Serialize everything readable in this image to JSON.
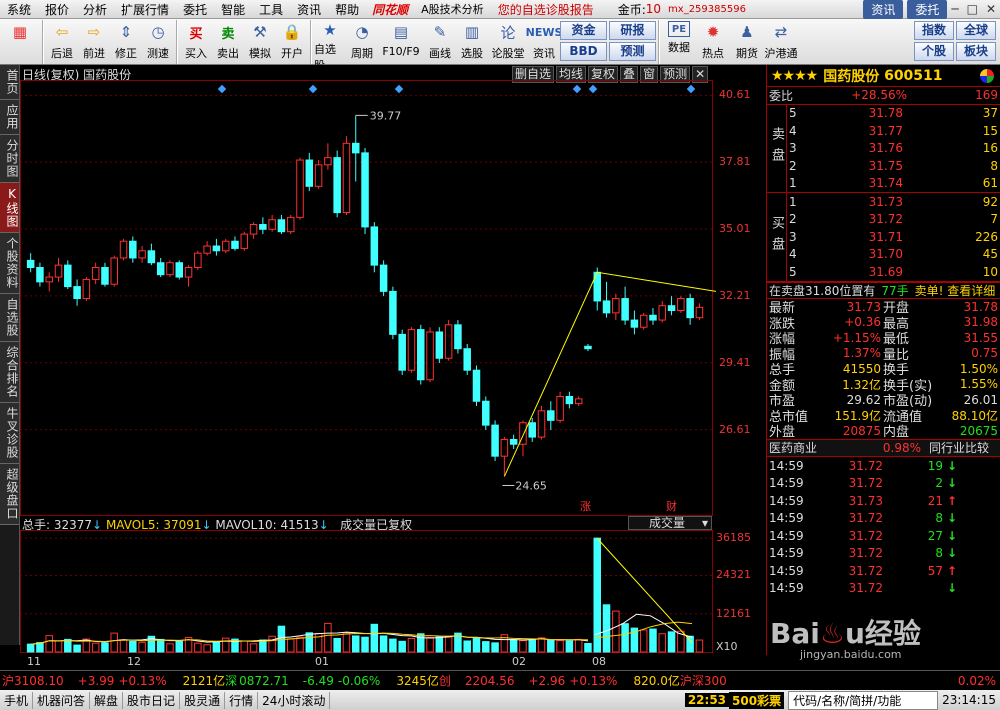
{
  "menu": {
    "items": [
      "系统",
      "报价",
      "分析",
      "扩展行情",
      "委托",
      "智能",
      "工具",
      "资讯",
      "帮助"
    ],
    "logo": "同花顺",
    "subtitle": "A股技术分析",
    "report": "您的自选诊股报告",
    "gold_label": "金币:",
    "gold_value": "10",
    "user": "mx_259385596",
    "btn_news": "资讯",
    "btn_trade": "委托"
  },
  "toolbar": {
    "buttons": [
      {
        "label": "",
        "icon": "grid-icon"
      },
      {
        "label": "后退",
        "icon": "back-arrow-icon"
      },
      {
        "label": "前进",
        "icon": "forward-arrow-icon"
      },
      {
        "label": "修正",
        "icon": "up-down-icon"
      },
      {
        "label": "测速",
        "icon": "clock-icon"
      },
      {
        "label": "买入",
        "icon": "buy-icon"
      },
      {
        "label": "卖出",
        "icon": "sell-icon"
      },
      {
        "label": "模拟",
        "icon": "hammer-icon"
      },
      {
        "label": "开户",
        "icon": "lock-icon"
      },
      {
        "label": "自选股",
        "icon": "star-icon"
      },
      {
        "label": "周期",
        "icon": "cycle-icon"
      },
      {
        "label": "F10/F9",
        "icon": "f10-icon"
      },
      {
        "label": "画线",
        "icon": "pen-icon"
      },
      {
        "label": "选股",
        "icon": "filter-icon"
      },
      {
        "label": "论股堂",
        "icon": "forum-icon"
      },
      {
        "label": "资讯",
        "icon": "news-icon"
      }
    ],
    "small1": [
      "资金",
      "研报",
      "BBD",
      "预测"
    ],
    "right_buttons": [
      {
        "label": "数据",
        "icon": "pe-icon"
      },
      {
        "label": "热点",
        "icon": "hot-icon"
      },
      {
        "label": "期货",
        "icon": "futures-icon"
      },
      {
        "label": "沪港通",
        "icon": "hk-icon"
      }
    ],
    "small2": [
      "指数",
      "全球",
      "个股",
      "板块"
    ]
  },
  "left_tabs": [
    "首页",
    "应用",
    "分时图",
    "K线图",
    "个股资料",
    "自选股",
    "综合排名",
    "牛叉诊股",
    "超级盘口"
  ],
  "chart": {
    "title": "日线(复权) 国药股份",
    "tools": [
      "删自选",
      "均线",
      "复权",
      "叠",
      "窗",
      "预测"
    ],
    "high_label": "39.77",
    "low_label": "24.65",
    "event1": "涨",
    "event2": "财"
  },
  "volume": {
    "total": "总手: 32377",
    "ma5": "MAVOL5: 37091",
    "ma10": "MAVOL10: 41513",
    "note": "成交量已复权",
    "select": "成交量",
    "unit": "X10"
  },
  "chart_data": [
    {
      "type": "candlestick",
      "title": "日线(复权) 国药股份",
      "y_ticks": [
        "40.61",
        "37.81",
        "35.01",
        "32.21",
        "29.41",
        "26.61"
      ],
      "ylim": [
        24.0,
        41.0
      ],
      "x_ticks": [
        "11",
        "12",
        "01",
        "02",
        "08"
      ],
      "candles": [
        [
          33.7,
          34.0,
          33.2,
          33.4
        ],
        [
          33.4,
          33.6,
          32.6,
          32.8
        ],
        [
          32.8,
          33.2,
          32.4,
          33.0
        ],
        [
          33.0,
          33.8,
          32.8,
          33.5
        ],
        [
          33.5,
          33.7,
          32.5,
          32.6
        ],
        [
          32.6,
          32.9,
          31.8,
          32.1
        ],
        [
          32.1,
          33.0,
          32.0,
          32.9
        ],
        [
          32.9,
          33.6,
          32.7,
          33.4
        ],
        [
          33.4,
          33.6,
          32.6,
          32.7
        ],
        [
          32.7,
          33.9,
          32.6,
          33.8
        ],
        [
          33.8,
          34.6,
          33.7,
          34.5
        ],
        [
          34.5,
          34.7,
          33.6,
          33.8
        ],
        [
          33.8,
          34.3,
          33.6,
          34.1
        ],
        [
          34.1,
          34.4,
          33.5,
          33.6
        ],
        [
          33.6,
          33.8,
          33.0,
          33.1
        ],
        [
          33.1,
          33.7,
          33.0,
          33.6
        ],
        [
          33.6,
          33.7,
          32.9,
          33.0
        ],
        [
          33.0,
          33.5,
          32.6,
          33.4
        ],
        [
          33.4,
          34.1,
          33.3,
          34.0
        ],
        [
          34.0,
          34.5,
          33.9,
          34.3
        ],
        [
          34.3,
          34.6,
          33.9,
          34.1
        ],
        [
          34.1,
          34.6,
          34.0,
          34.5
        ],
        [
          34.5,
          34.7,
          34.1,
          34.2
        ],
        [
          34.2,
          34.9,
          34.1,
          34.8
        ],
        [
          34.8,
          35.3,
          34.6,
          35.2
        ],
        [
          35.2,
          35.5,
          34.8,
          35.0
        ],
        [
          35.0,
          35.6,
          34.9,
          35.4
        ],
        [
          35.4,
          35.6,
          34.8,
          34.9
        ],
        [
          34.9,
          35.6,
          34.8,
          35.5
        ],
        [
          35.5,
          38.0,
          35.4,
          37.9
        ],
        [
          37.9,
          38.2,
          36.6,
          36.8
        ],
        [
          36.8,
          37.9,
          36.7,
          37.7
        ],
        [
          37.7,
          38.6,
          37.5,
          38.0
        ],
        [
          38.0,
          38.3,
          35.5,
          35.7
        ],
        [
          35.7,
          38.9,
          35.6,
          38.6
        ],
        [
          38.6,
          39.77,
          37.0,
          38.2
        ],
        [
          38.2,
          38.4,
          34.8,
          35.1
        ],
        [
          35.1,
          35.3,
          33.2,
          33.5
        ],
        [
          33.5,
          33.7,
          32.2,
          32.4
        ],
        [
          32.4,
          32.6,
          30.4,
          30.6
        ],
        [
          30.6,
          30.8,
          28.9,
          29.1
        ],
        [
          29.1,
          30.9,
          29.0,
          30.8
        ],
        [
          30.8,
          31.0,
          28.5,
          28.7
        ],
        [
          28.7,
          30.9,
          28.6,
          30.7
        ],
        [
          30.7,
          30.9,
          29.4,
          29.6
        ],
        [
          29.6,
          31.2,
          29.5,
          31.0
        ],
        [
          31.0,
          31.2,
          29.8,
          30.0
        ],
        [
          30.0,
          30.2,
          28.9,
          29.1
        ],
        [
          29.1,
          29.3,
          27.6,
          27.8
        ],
        [
          27.8,
          28.0,
          26.6,
          26.8
        ],
        [
          26.8,
          27.0,
          25.3,
          25.5
        ],
        [
          25.5,
          26.3,
          24.65,
          26.2
        ],
        [
          26.2,
          26.4,
          25.8,
          26.0
        ],
        [
          26.0,
          27.0,
          25.5,
          26.9
        ],
        [
          26.9,
          27.1,
          26.1,
          26.3
        ],
        [
          26.3,
          27.6,
          26.2,
          27.4
        ],
        [
          27.4,
          27.8,
          26.6,
          27.0
        ],
        [
          27.0,
          28.2,
          26.9,
          28.0
        ],
        [
          28.0,
          28.2,
          27.5,
          27.7
        ],
        [
          27.7,
          28.0,
          27.6,
          27.9
        ],
        [
          30.1,
          30.2,
          29.9,
          30.0
        ],
        [
          33.2,
          33.4,
          31.6,
          32.0
        ],
        [
          32.0,
          32.8,
          31.3,
          31.5
        ],
        [
          31.5,
          32.3,
          31.2,
          32.1
        ],
        [
          32.1,
          32.6,
          31.0,
          31.2
        ],
        [
          31.2,
          31.6,
          30.6,
          30.9
        ],
        [
          30.9,
          31.5,
          30.8,
          31.4
        ],
        [
          31.4,
          31.7,
          31.0,
          31.2
        ],
        [
          31.2,
          32.0,
          31.1,
          31.8
        ],
        [
          31.8,
          32.2,
          31.4,
          31.6
        ],
        [
          31.6,
          32.2,
          31.5,
          32.1
        ],
        [
          32.1,
          32.3,
          31.0,
          31.3
        ],
        [
          31.3,
          31.9,
          31.2,
          31.73
        ]
      ],
      "trendline": [
        [
          24.65,
          51
        ],
        [
          33.2,
          61
        ],
        [
          32.2,
          77
        ]
      ]
    },
    {
      "type": "bar",
      "title": "成交量",
      "y_ticks": [
        "36185",
        "24321",
        "12161"
      ],
      "ylim": [
        0,
        37500
      ],
      "values": [
        2500,
        3000,
        5200,
        3500,
        4000,
        2200,
        4100,
        2800,
        2900,
        6000,
        3800,
        3400,
        3100,
        5000,
        4000,
        2600,
        3400,
        4600,
        2800,
        2300,
        3100,
        4400,
        4100,
        3500,
        2600,
        3800,
        5000,
        8200,
        4200,
        4700,
        6100,
        5900,
        9100,
        4300,
        6100,
        5100,
        4700,
        8800,
        5100,
        4100,
        3400,
        4300,
        5800,
        4600,
        4800,
        4700,
        6000,
        3500,
        4400,
        3300,
        2900,
        5500,
        3700,
        3600,
        4000,
        4500,
        3800,
        3600,
        3500,
        4000,
        2700,
        36185,
        15000,
        13000,
        9000,
        7600,
        7000,
        7300,
        5800,
        6400,
        6600,
        5000,
        3800
      ],
      "ma_5": [
        5500,
        7000,
        9000,
        12000,
        11500,
        9000,
        6000,
        4700
      ],
      "ma_10": [
        4500,
        5000,
        5500,
        6500,
        8000,
        9000,
        9500,
        9000
      ]
    }
  ],
  "stock": {
    "stars": "★★★★",
    "name": "国药股份",
    "code": "600511",
    "weibi_label": "委比",
    "weibi": "+28.56%",
    "weicha": "169",
    "sell_label": "卖盘",
    "buy_label": "买盘",
    "asks": [
      [
        "5",
        "31.78",
        "37"
      ],
      [
        "4",
        "31.77",
        "15"
      ],
      [
        "3",
        "31.76",
        "16"
      ],
      [
        "2",
        "31.75",
        "8"
      ],
      [
        "1",
        "31.74",
        "61"
      ]
    ],
    "bids": [
      [
        "1",
        "31.73",
        "92"
      ],
      [
        "2",
        "31.72",
        "7"
      ],
      [
        "3",
        "31.71",
        "226"
      ],
      [
        "4",
        "31.70",
        "45"
      ],
      [
        "5",
        "31.69",
        "10"
      ]
    ],
    "order_info": "在卖盘31.80位置有",
    "order_qty": "77手",
    "order_action": "卖单! 查看详细",
    "quote": [
      [
        "最新",
        "31.73",
        "开盘",
        "31.78"
      ],
      [
        "涨跌",
        "+0.36",
        "最高",
        "31.98"
      ],
      [
        "涨幅",
        "+1.15%",
        "最低",
        "31.55"
      ],
      [
        "振幅",
        "1.37%",
        "量比",
        "0.75"
      ],
      [
        "总手",
        "41550",
        "换手",
        "1.50%"
      ],
      [
        "金额",
        "1.32亿",
        "换手(实)",
        "1.55%"
      ],
      [
        "市盈",
        "29.62",
        "市盈(动)",
        "26.01"
      ],
      [
        "总市值",
        "151.9亿",
        "流通值",
        "88.10亿"
      ],
      [
        "外盘",
        "20875",
        "内盘",
        "20675"
      ]
    ],
    "sector": "医药商业",
    "sector_pct": "0.98%",
    "compare": "同行业比较",
    "ticks": [
      [
        "14:59",
        "31.72",
        "19",
        "down"
      ],
      [
        "14:59",
        "31.72",
        "2",
        "down"
      ],
      [
        "14:59",
        "31.73",
        "21",
        "up"
      ],
      [
        "14:59",
        "31.72",
        "8",
        "down"
      ],
      [
        "14:59",
        "31.72",
        "27",
        "down"
      ],
      [
        "14:59",
        "31.72",
        "8",
        "down"
      ],
      [
        "14:59",
        "31.72",
        "57",
        "up"
      ],
      [
        "14:59",
        "31.72",
        "",
        "down"
      ]
    ]
  },
  "bottom": {
    "sh_label": "沪",
    "sh": "3108.10",
    "sh_chg": "+3.99",
    "sh_pct": "+0.13%",
    "sh_amt": "2121亿",
    "sz_label": "深",
    "sz": "0872.71",
    "sz_chg": "-6.49",
    "sz_pct": "-0.06%",
    "sz_amt": "3245亿",
    "cy_label": "创",
    "cy": "2204.56",
    "cy_chg": "+2.96",
    "cy_pct": "+0.13%",
    "cy_amt": "820.0亿",
    "hs_label": "沪深300",
    "hs_pct": "0.02%"
  },
  "status": {
    "items": [
      "手机",
      "机器问答",
      "解盘",
      "股市日记",
      "股灵通",
      "行情",
      "24小时滚动"
    ],
    "clock1": "22:53",
    "lottery": "500彩票",
    "search": "代码/名称/简拼/功能",
    "clock2": "23:14:15"
  },
  "watermark": "Baidu经验",
  "watermark_url": "jingyan.baidu.com",
  "colors": {
    "up": "#ff3030",
    "down": "#40ffff",
    "bg": "#000000",
    "grid": "#8a0000",
    "ma5": "#ffffff",
    "ma10": "#ffd200"
  }
}
